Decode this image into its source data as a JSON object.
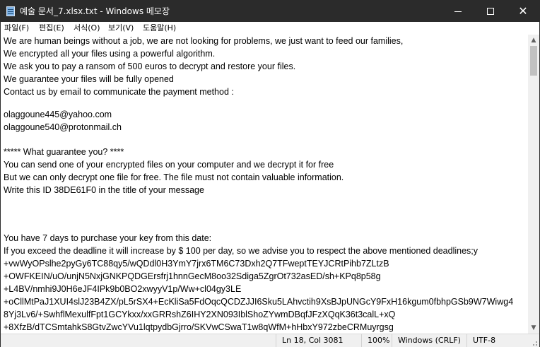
{
  "window": {
    "title": "예술 문서_7.xlsx.txt - Windows 메모장",
    "minimize_glyph": "",
    "maximize_glyph": "",
    "close_glyph": "✕"
  },
  "menu": [
    {
      "label": "파일(F)"
    },
    {
      "label": "편집(E)"
    },
    {
      "label": "서식(O)"
    },
    {
      "label": "보기(V)"
    },
    {
      "label": "도움말(H)"
    }
  ],
  "editor": {
    "lines": [
      "We are human beings without a job, we are not looking for problems, we just want to feed our families,",
      "We encrypted all your files using a powerful algorithm.",
      "We ask you to pay a ransom of 500 euros to decrypt and restore your files.",
      "We guarantee your files will be fully opened",
      "Contact us by email to communicate the payment method :",
      "",
      "olaggoune445@yahoo.com",
      "olaggoune540@protonmail.ch",
      "",
      "***** What guarantee you? ****",
      "You can send one of your encrypted files on your computer and we decrypt it for free",
      "But we can only decrypt one file for free. The file must not contain valuable information.",
      "Write this ID 38DE61F0 in the title of your message",
      "",
      "",
      "",
      "You have 7 days to purchase your key from this date:",
      "If you exceed the deadline it will increase by $ 100 per day, so we advise you to respect the above mentioned deadlines;y",
      "+vwWyOPslhe2pyGy6TC88qy5/wQDdl0H3YmY7jrx6TM6C73Dxh2Q7TFweptTEYJCRtPihb7ZLtzB",
      "+OWFKEIN/uO/unjN5NxjGNKPQDGErsfrj1hnnGecM8oo32Sdiga5ZgrOt732asED/sh+KPq8p58g",
      "+L4BV/nmhi9J0H6eJF4IPk9b0BO2xwyyV1p/Ww+cl04gy3LE",
      "+oCllMtPaJ1XUI4slJ23B4ZX/pL5rSX4+EcKliSa5FdOqcQCDZJJI6Sku5LAhvctih9XsBJpUNGcY9FxH16kgum0fbhpGSb9W7Wiwg4",
      "8Yj3Lv6/+SwhflMexulfFpt1GCYkxx/xxGRRshZ6IHY2XN093IblShoZYwmDBqfJFzXQqK36t3calL+xQ",
      "+8XfzB/dTCSmtahkS8GtvZwcYVu1lqtpydbGjrro/SKVwCSwaT1w8qWfM+hHbxY972zbeCRMuyrgsg"
    ]
  },
  "scrollbar": {
    "up_glyph": "▲",
    "down_glyph": "▼"
  },
  "status": {
    "position": "Ln 18, Col 3081",
    "zoom": "100%",
    "line_ending": "Windows (CRLF)",
    "encoding": "UTF-8"
  }
}
